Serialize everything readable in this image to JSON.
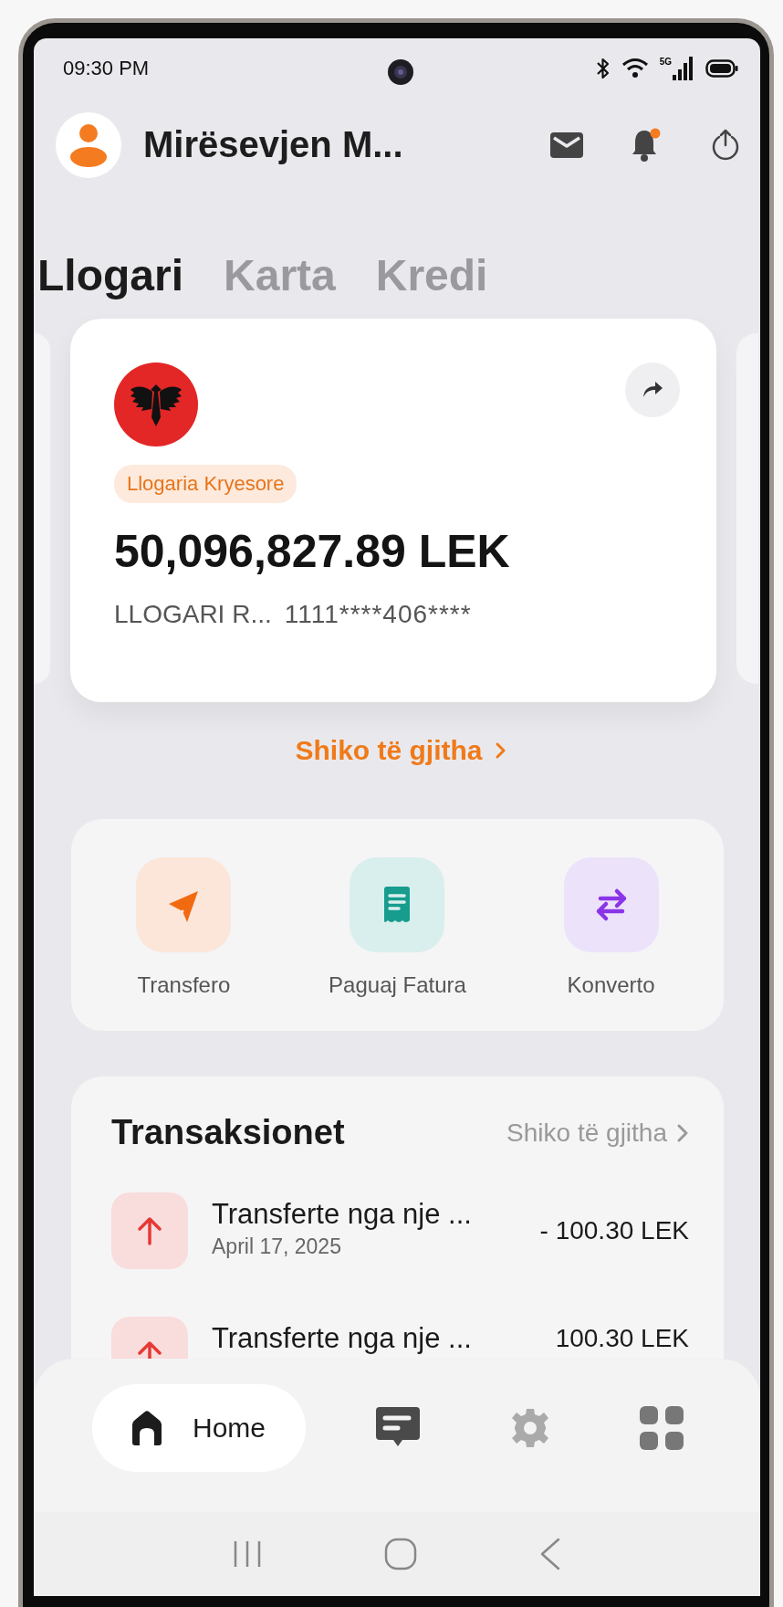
{
  "status_bar": {
    "time": "09:30 PM",
    "network": "5G"
  },
  "header": {
    "greeting": "Mirësevjen M..."
  },
  "tabs": [
    {
      "label": "Llogari",
      "selected": true
    },
    {
      "label": "Karta",
      "selected": false
    },
    {
      "label": "Kredi",
      "selected": false
    }
  ],
  "account_card": {
    "tag": "Llogaria Kryesore",
    "balance": "50,096,827.89 LEK",
    "account_name": "LLOGARI R...",
    "account_number": "1111****406****"
  },
  "see_all_accounts": "Shiko të gjitha",
  "quick_actions": [
    {
      "kind": "transfer",
      "label": "Transfero"
    },
    {
      "kind": "bill",
      "label": "Paguaj Fatura"
    },
    {
      "kind": "convert",
      "label": "Konverto"
    }
  ],
  "transactions": {
    "title": "Transaksionet",
    "see_all": "Shiko të gjitha",
    "rows": [
      {
        "description": "Transferte nga nje ...",
        "date": "April 17, 2025",
        "amount": "- 100.30 LEK"
      },
      {
        "description": "Transferte nga nje ...",
        "amount": "100.30 LEK"
      }
    ]
  },
  "bottom_nav": [
    {
      "kind": "home",
      "label": "Home",
      "selected": true
    },
    {
      "kind": "chat",
      "selected": false
    },
    {
      "kind": "settings",
      "selected": false
    },
    {
      "kind": "apps",
      "selected": false
    }
  ]
}
